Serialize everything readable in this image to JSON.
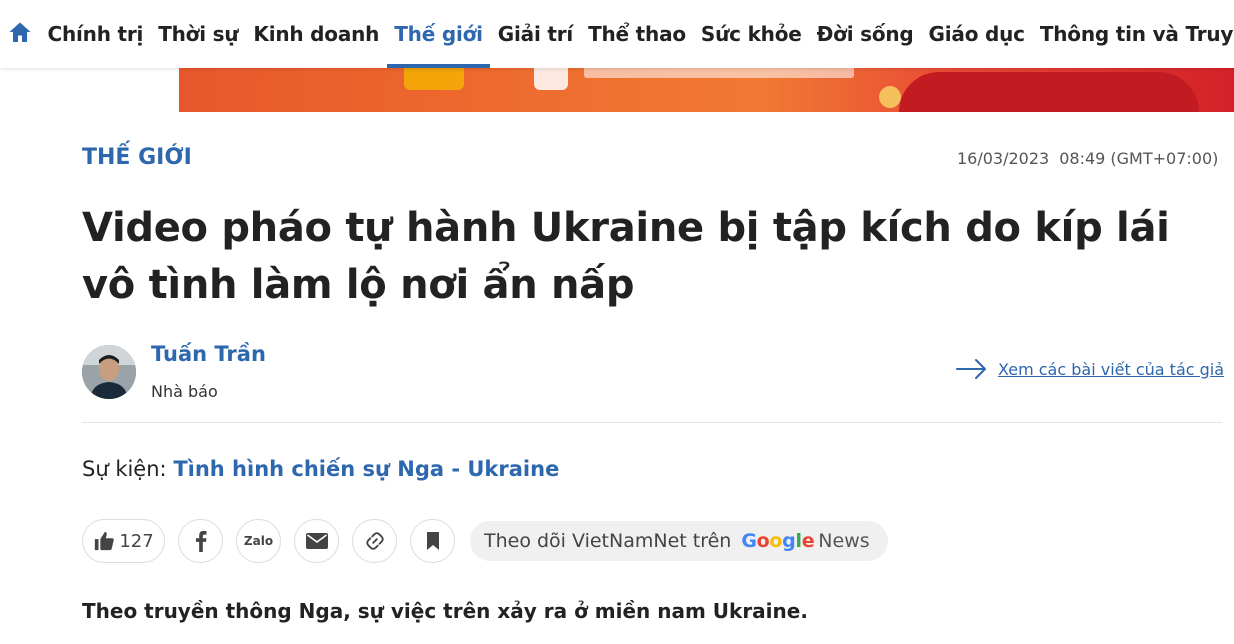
{
  "nav": {
    "home_icon": "home-icon",
    "items": [
      {
        "label": "Chính trị"
      },
      {
        "label": "Thời sự"
      },
      {
        "label": "Kinh doanh"
      },
      {
        "label": "Thế giới"
      },
      {
        "label": "Giải trí"
      },
      {
        "label": "Thể thao"
      },
      {
        "label": "Sức khỏe"
      },
      {
        "label": "Đời sống"
      },
      {
        "label": "Giáo dục"
      },
      {
        "label": "Thông tin và Truyền thông"
      }
    ],
    "active_index": 3,
    "active_color": "#2d67ad"
  },
  "article": {
    "category": "THẾ GIỚI",
    "date": "16/03/2023",
    "time": "08:49 (GMT+07:00)",
    "title": "Video pháo tự hành Ukraine bị tập kích do kíp lái vô tình làm lộ nơi ẩn nấp",
    "author": {
      "name": "Tuấn Trần",
      "role": "Nhà báo",
      "link_text": "Xem các bài viết của tác giả"
    },
    "event": {
      "label": "Sự kiện:",
      "link": "Tình hình chiến sự Nga - Ukraine"
    },
    "share": {
      "like_count": "127",
      "zalo_label": "Zalo",
      "follow_text": "Theo dõi VietNamNet trên",
      "google_letters": [
        "G",
        "o",
        "o",
        "g",
        "l",
        "e"
      ],
      "news_text": "News"
    },
    "sapo": "Theo truyền thông Nga, sự việc trên xảy ra ở miền nam Ukraine."
  }
}
